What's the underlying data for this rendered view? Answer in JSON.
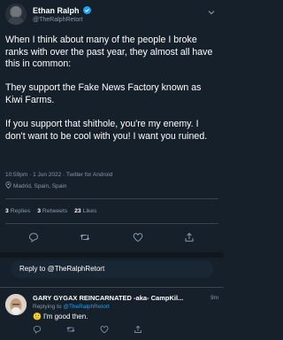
{
  "tweet": {
    "author_name": "Ethan Ralph",
    "author_handle": "@TheRalphRetort",
    "text": "When I think about many of the people I broke ranks with over the past year, they almost all have this in common:\n\nThey support the Fake News Factory known as Kiwi Farms.\n\nIf you support that shithole, you're my enemy. I don't want to be cool with you! I want you ruined.",
    "meta": "10:59pm · 1 Jun 2022 · Twitter for Android",
    "location": "Madrid, Spain, Spain",
    "stats": {
      "replies_count": "3",
      "replies_label": "Replies",
      "retweets_count": "3",
      "retweets_label": "Retweets",
      "likes_count": "23",
      "likes_label": "Likes"
    }
  },
  "reply_box": {
    "placeholder": "Reply to @TheRalphRetort"
  },
  "reply": {
    "author_name": "GARY GYGAX REINCARNATED -aka- CampKil...",
    "time": "9m",
    "replying_prefix": "Replying to",
    "replying_handle": "@TheRalphRetort",
    "emoji": "🙂",
    "text": "I'm good then."
  },
  "icons": {
    "verified": "verified-badge-icon",
    "chevron": "chevron-down-icon",
    "location": "location-pin-icon",
    "reply": "reply-icon",
    "retweet": "retweet-icon",
    "like": "heart-icon",
    "share": "share-icon"
  },
  "colors": {
    "background": "#15202b",
    "secondary_text": "#8899a6",
    "accent": "#1da1f2"
  }
}
